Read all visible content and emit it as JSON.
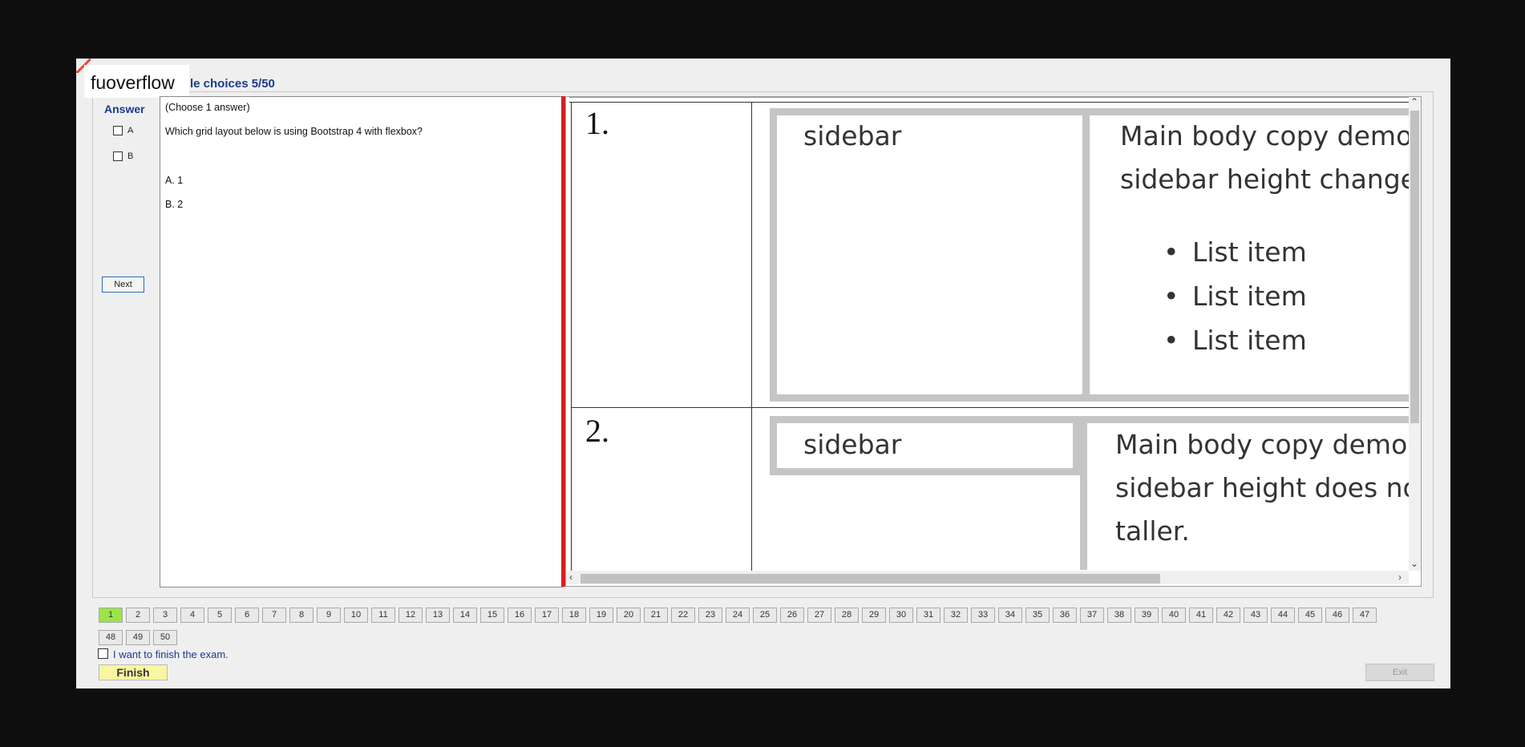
{
  "header": {
    "logo_text": "fuoverflow",
    "section_title": "le choices 5/50"
  },
  "answer_panel": {
    "label": "Answer",
    "options": [
      "A",
      "B"
    ],
    "next_label": "Next"
  },
  "question": {
    "instruction": "(Choose 1 answer)",
    "text": "Which grid layout below is using Bootstrap 4 with flexbox?",
    "choices": [
      "A.  1",
      "B.  2"
    ]
  },
  "figure": {
    "row1": {
      "number": "1.",
      "sidebar": "sidebar",
      "body_line1": "Main body copy demor",
      "body_line2": "sidebar height changes",
      "list_items": [
        "List item",
        "List item",
        "List item"
      ]
    },
    "row2": {
      "number": "2.",
      "sidebar": "sidebar",
      "body_line1": "Main body copy demon",
      "body_line2": "sidebar height does not",
      "body_line3": "taller."
    }
  },
  "pagination": {
    "current": 1,
    "pages": [
      "1",
      "2",
      "3",
      "4",
      "5",
      "6",
      "7",
      "8",
      "9",
      "10",
      "11",
      "12",
      "13",
      "14",
      "15",
      "16",
      "17",
      "18",
      "19",
      "20",
      "21",
      "22",
      "23",
      "24",
      "25",
      "26",
      "27",
      "28",
      "29",
      "30",
      "31",
      "32",
      "33",
      "34",
      "35",
      "36",
      "37",
      "38",
      "39",
      "40",
      "41",
      "42",
      "43",
      "44",
      "45",
      "46",
      "47",
      "48",
      "49",
      "50"
    ]
  },
  "footer": {
    "finish_checkbox_label": "I want to finish the exam.",
    "finish_label": "Finish",
    "exit_label": "Exit"
  },
  "colors": {
    "accent_blue": "#1a3a8e",
    "divider_red": "#d52020",
    "current_page_green": "#9be34a",
    "finish_yellow": "#f8f6a0"
  }
}
